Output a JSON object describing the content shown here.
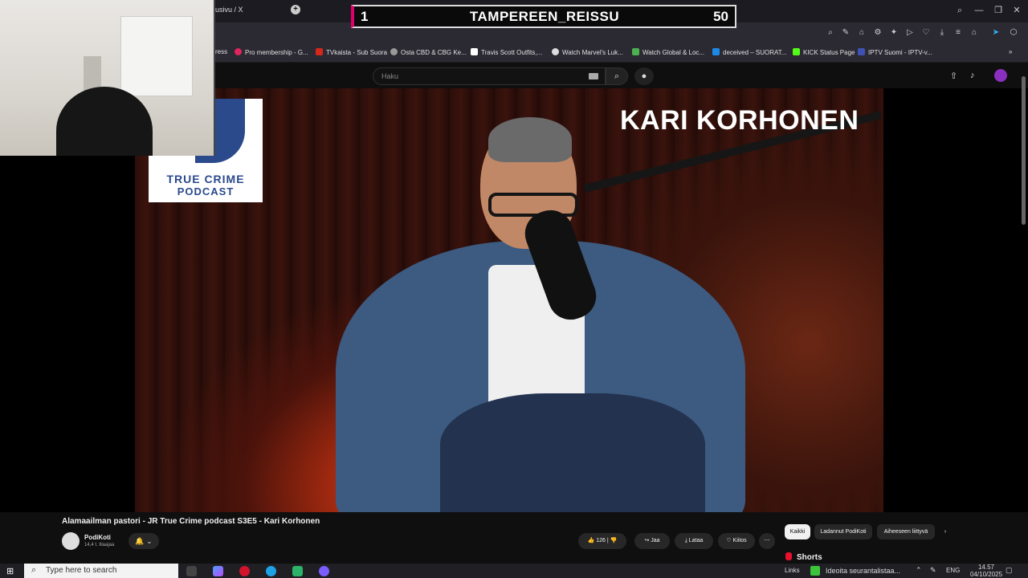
{
  "browser": {
    "tab_title": "usivu / X",
    "new_tab_glyph": "+",
    "window_controls": {
      "minimize": "—",
      "restore": "❐",
      "close": "✕"
    },
    "search_glyph": "⌕"
  },
  "scoreboard": {
    "rank": "1",
    "name": "TAMPEREEN_REISSU",
    "value": "50",
    "accent_color": "#e0006a"
  },
  "bookmarks": [
    {
      "label": "ress",
      "color": "#888888"
    },
    {
      "label": "Pro membership - G...",
      "color": "#e0245e"
    },
    {
      "label": "TVkaista - Sub Suora",
      "color": "#d4281a"
    },
    {
      "label": "Osta CBD & CBG Ke...",
      "color": "#999999"
    },
    {
      "label": "Travis Scott Outfits,...",
      "color": "#ffffff"
    },
    {
      "label": "Watch Marvel's Luk...",
      "color": "#dddddd"
    },
    {
      "label": "Watch Global & Loc...",
      "color": "#4caf50"
    },
    {
      "label": "deceived – SUORAT...",
      "color": "#1e88e5"
    },
    {
      "label": "KICK Status Page",
      "color": "#53fc18"
    },
    {
      "label": "IPTV Suomi - IPTV-v...",
      "color": "#3f51b5"
    }
  ],
  "youtube": {
    "search_placeholder": "Haku",
    "video_overlay_name": "KARI KORHONEN",
    "logo_line1": "TRUE CRIME",
    "logo_line2": "PODCAST",
    "logo_color": "#2a4a8c",
    "video_title": "Alamaailman pastori - JR True Crime podcast S3E5 - Kari Korhonen",
    "channel_name": "PodiKoti",
    "channel_subs": "14,4 t. tilaajaa",
    "like_count": "126",
    "share_label": "Jaa",
    "download_label": "Lataa",
    "thanks_label": "Kiitos",
    "more_glyph": "⋯",
    "chips": [
      "Kaikki",
      "Ladannut PodiKoti",
      "Aiheeseen liittyvä"
    ],
    "chip_next": "›",
    "shorts_label": "Shorts"
  },
  "taskbar": {
    "search_placeholder": "Type here to search",
    "links_label": "Links",
    "news_text": "Ideoita seurantalistaa...",
    "lang": "ENG",
    "time": "14.57",
    "date": "04/10/2025"
  }
}
